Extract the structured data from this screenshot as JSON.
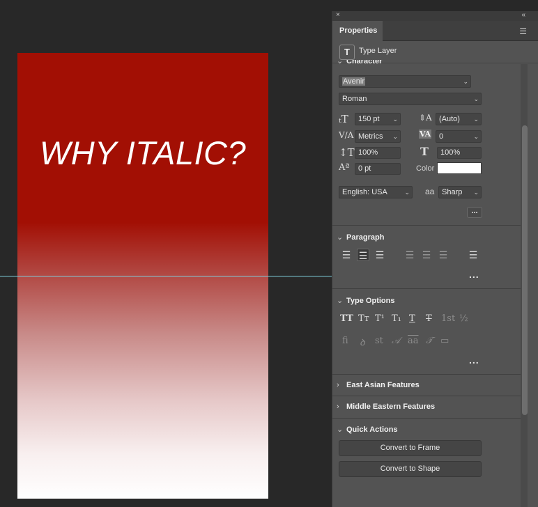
{
  "canvas": {
    "text": "WHY ITALIC?",
    "colors": {
      "top": "#a20f04",
      "bottom": "#ffffff",
      "guide": "#7fd0df"
    }
  },
  "panel": {
    "close_glyph": "×",
    "collapse_glyph": "«",
    "tab_label": "Properties",
    "menu_icon": "hamburger-icon",
    "layer_icon_glyph": "T",
    "layer_label": "Type Layer"
  },
  "character": {
    "header": "Character",
    "font_family": "Avenir",
    "font_style": "Roman",
    "font_size": "150 pt",
    "leading": "(Auto)",
    "kerning": "Metrics",
    "tracking": "0",
    "vertical_scale": "100%",
    "horizontal_scale": "100%",
    "baseline_shift": "0 pt",
    "color_label": "Color",
    "color_value": "#ffffff",
    "language": "English: USA",
    "antialias_glyph": "aa",
    "antialias": "Sharp",
    "more": "..."
  },
  "paragraph": {
    "header": "Paragraph",
    "more": "..."
  },
  "type_options": {
    "header": "Type Options",
    "row1": [
      "TT",
      "Tт",
      "T¹",
      "T₁",
      "T",
      "T",
      "1st",
      "½"
    ],
    "row2": [
      "fi",
      "ꝺ",
      "st",
      "𝒜",
      "aa",
      "𝒯",
      "▭"
    ],
    "more": "..."
  },
  "sections": {
    "east_asian": "East Asian Features",
    "middle_eastern": "Middle Eastern Features",
    "quick_actions": "Quick Actions"
  },
  "quick_actions": {
    "convert_frame": "Convert to Frame",
    "convert_shape": "Convert to Shape"
  }
}
